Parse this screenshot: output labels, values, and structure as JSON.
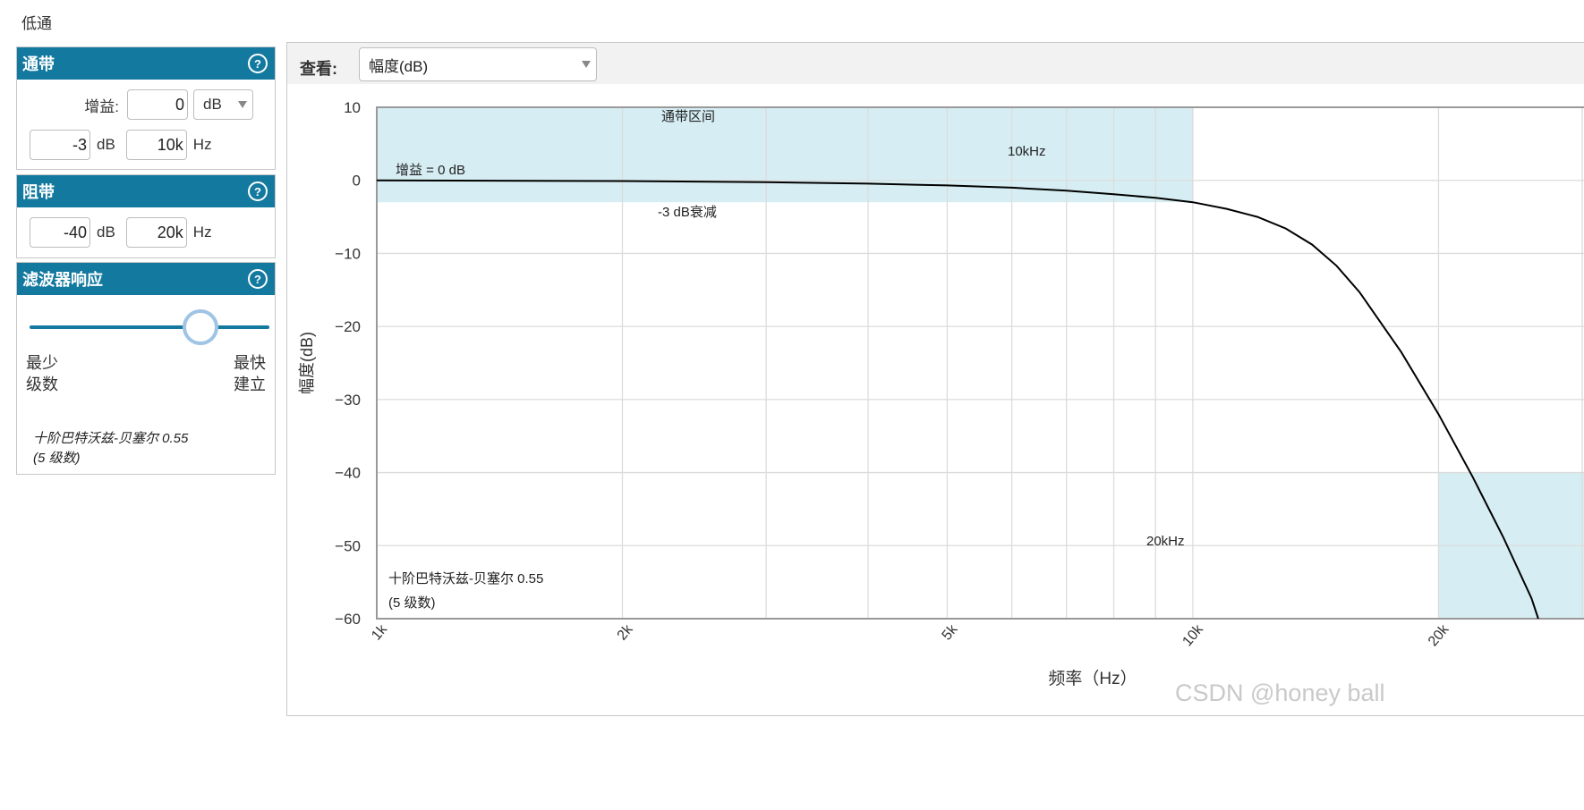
{
  "page_title": "低通",
  "passband": {
    "title": "通带",
    "gain_label": "增益:",
    "gain_value": "0",
    "gain_unit_selected": "dB",
    "atten_value": "-3",
    "atten_unit": "dB",
    "freq_value": "10k",
    "freq_unit": "Hz"
  },
  "stopband": {
    "title": "阻带",
    "atten_value": "-40",
    "atten_unit": "dB",
    "freq_value": "20k",
    "freq_unit": "Hz"
  },
  "response": {
    "title": "滤波器响应",
    "slider_position": 0.7,
    "left_label_1": "最少",
    "left_label_2": "级数",
    "right_label_1": "最快",
    "right_label_2": "建立",
    "desc_1": "十阶巴特沃兹-贝塞尔 0.55",
    "desc_2": "(5 级数)"
  },
  "view": {
    "label": "查看:",
    "selected": "幅度(dB)"
  },
  "colors": {
    "header_blue": "#13799f",
    "region_fill": "#d6eef3",
    "curve": "#000000"
  },
  "chart_data": {
    "type": "line",
    "xscale": "log",
    "xlim": [
      1000,
      31000
    ],
    "ylim": [
      -60,
      10
    ],
    "ylabel": "幅度(dB)",
    "xlabel": "频率（Hz）",
    "x_ticks": [
      {
        "v": 1000,
        "label": "1k"
      },
      {
        "v": 2000,
        "label": "2k"
      },
      {
        "v": 5000,
        "label": "5k"
      },
      {
        "v": 10000,
        "label": "10k"
      },
      {
        "v": 20000,
        "label": "20k"
      }
    ],
    "y_ticks": [
      {
        "v": 10,
        "label": "10"
      },
      {
        "v": 0,
        "label": "0"
      },
      {
        "v": -10,
        "label": "−10"
      },
      {
        "v": -20,
        "label": "−20"
      },
      {
        "v": -30,
        "label": "−30"
      },
      {
        "v": -40,
        "label": "−40"
      },
      {
        "v": -50,
        "label": "−50"
      },
      {
        "v": -60,
        "label": "−60"
      }
    ],
    "series": [
      {
        "x": [
          1000,
          2000,
          3000,
          4000,
          5000,
          6000,
          7000,
          8000,
          9000,
          10000,
          11000,
          12000,
          13000,
          14000,
          15000,
          16000,
          18000,
          20000,
          22000,
          24000,
          26000,
          26500
        ],
        "y": [
          0,
          -0.1,
          -0.25,
          -0.45,
          -0.7,
          -1.0,
          -1.4,
          -1.9,
          -2.4,
          -3.0,
          -3.9,
          -5.0,
          -6.6,
          -8.8,
          -11.7,
          -15.3,
          -23.5,
          -32.0,
          -40.5,
          -48.8,
          -57.2,
          -60
        ]
      }
    ],
    "regions": [
      {
        "x0": 1000,
        "x1": 10000,
        "y0": -3,
        "y1": 10
      },
      {
        "x0": 20000,
        "x1": 31000,
        "y0": -60,
        "y1": -40
      }
    ],
    "annotations": {
      "passband_region": "通带区间",
      "freq_10k": "10kHz",
      "gain_note": "增益 = 0 dB",
      "atten_note": "-3 dB衰减",
      "freq_20k": "20kHz",
      "filter_name": "十阶巴特沃兹-贝塞尔 0.55",
      "filter_stages": "(5 级数)"
    }
  },
  "watermark": "CSDN @honey ball"
}
